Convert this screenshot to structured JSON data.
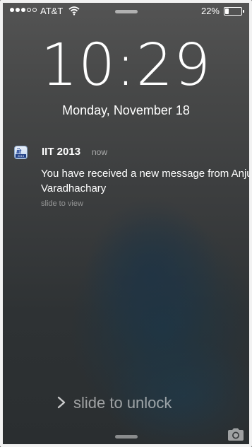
{
  "status_bar": {
    "signal_bars": 3,
    "signal_total": 5,
    "carrier": "AT&T",
    "wifi_icon": "wifi-icon",
    "battery_percent_label": "22%",
    "battery_level": 0.22
  },
  "lock": {
    "time": "10:29",
    "date": "Monday, November 18"
  },
  "notification": {
    "app_icon": "iit-2013-app-icon",
    "app_name": "IIT 2013",
    "time_ago": "now",
    "message": "You have received a new message from Anju Varadhachary",
    "hint": "slide to view",
    "icon_mark": "iit",
    "icon_year": "2013"
  },
  "unlock": {
    "chevron_icon": "chevron-right-icon",
    "label": "slide to unlock"
  },
  "camera_icon": "camera-icon",
  "colors": {
    "text": "#ffffff",
    "dim_text": "#9a9a9a",
    "frame": "#f2f2f2"
  }
}
